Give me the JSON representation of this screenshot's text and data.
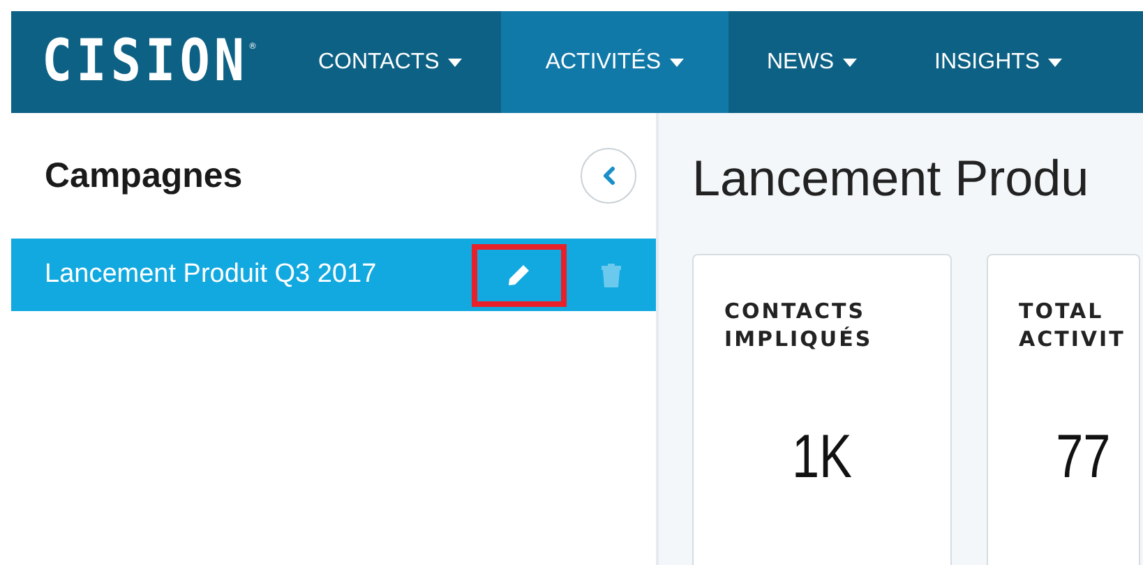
{
  "logo": {
    "text": "CISION",
    "mark": "®"
  },
  "nav": [
    {
      "label": "CONTACTS",
      "selected": false
    },
    {
      "label": "ACTIVITÉS",
      "selected": true
    },
    {
      "label": "NEWS",
      "selected": false
    },
    {
      "label": "INSIGHTS",
      "selected": false
    }
  ],
  "sidebar": {
    "title": "Campagnes",
    "items": [
      {
        "label": "Lancement Produit Q3 2017",
        "selected": true,
        "edit_highlighted": true
      }
    ]
  },
  "main": {
    "title": "Lancement Produ",
    "cards": [
      {
        "label": "CONTACTS IMPLIQUÉS",
        "value": "1K"
      },
      {
        "label": "TOTAL ACTIVIT",
        "value": "77"
      }
    ]
  }
}
